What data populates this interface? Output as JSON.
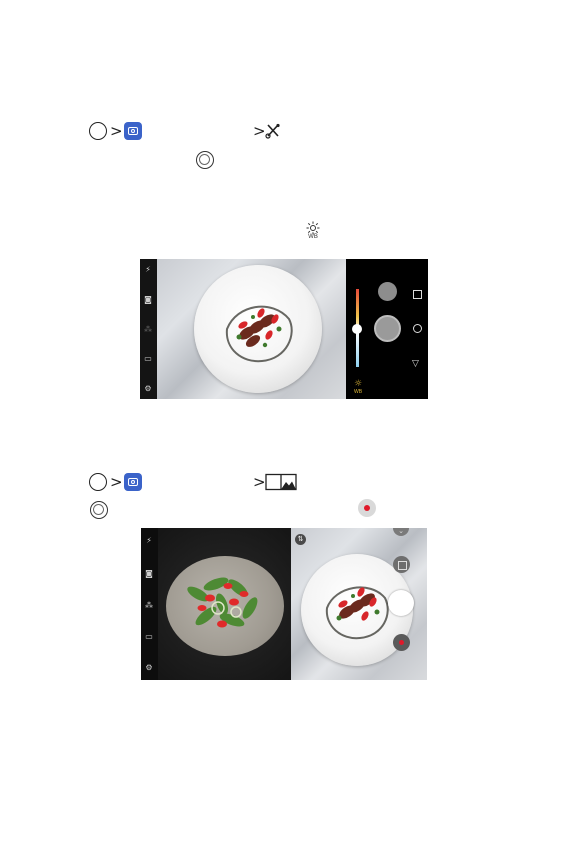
{
  "section1": {
    "step_icons": [
      "home-circle-icon",
      "camera-app-icon",
      "manual-mode-icon"
    ],
    "separator": ">",
    "shutter_icon": "shutter-button-icon",
    "wb_icon_label": "WB"
  },
  "screenshot1": {
    "panel_wb_label": "WB",
    "colors": {
      "slider_gradient": [
        "#e84a3a",
        "#f1c34a",
        "#ffffff",
        "#8fd1f0"
      ],
      "wb_icon": "#e0b93a"
    }
  },
  "section2": {
    "step_icons": [
      "home-circle-icon",
      "camera-app-icon",
      "match-shot-icon"
    ],
    "separator": ">",
    "shutter_icon": "shutter-button-icon",
    "record_icon": "record-button-icon"
  },
  "screenshot2": {
    "colors": {
      "record": "#e0192a",
      "left_bg": "#151515"
    }
  }
}
